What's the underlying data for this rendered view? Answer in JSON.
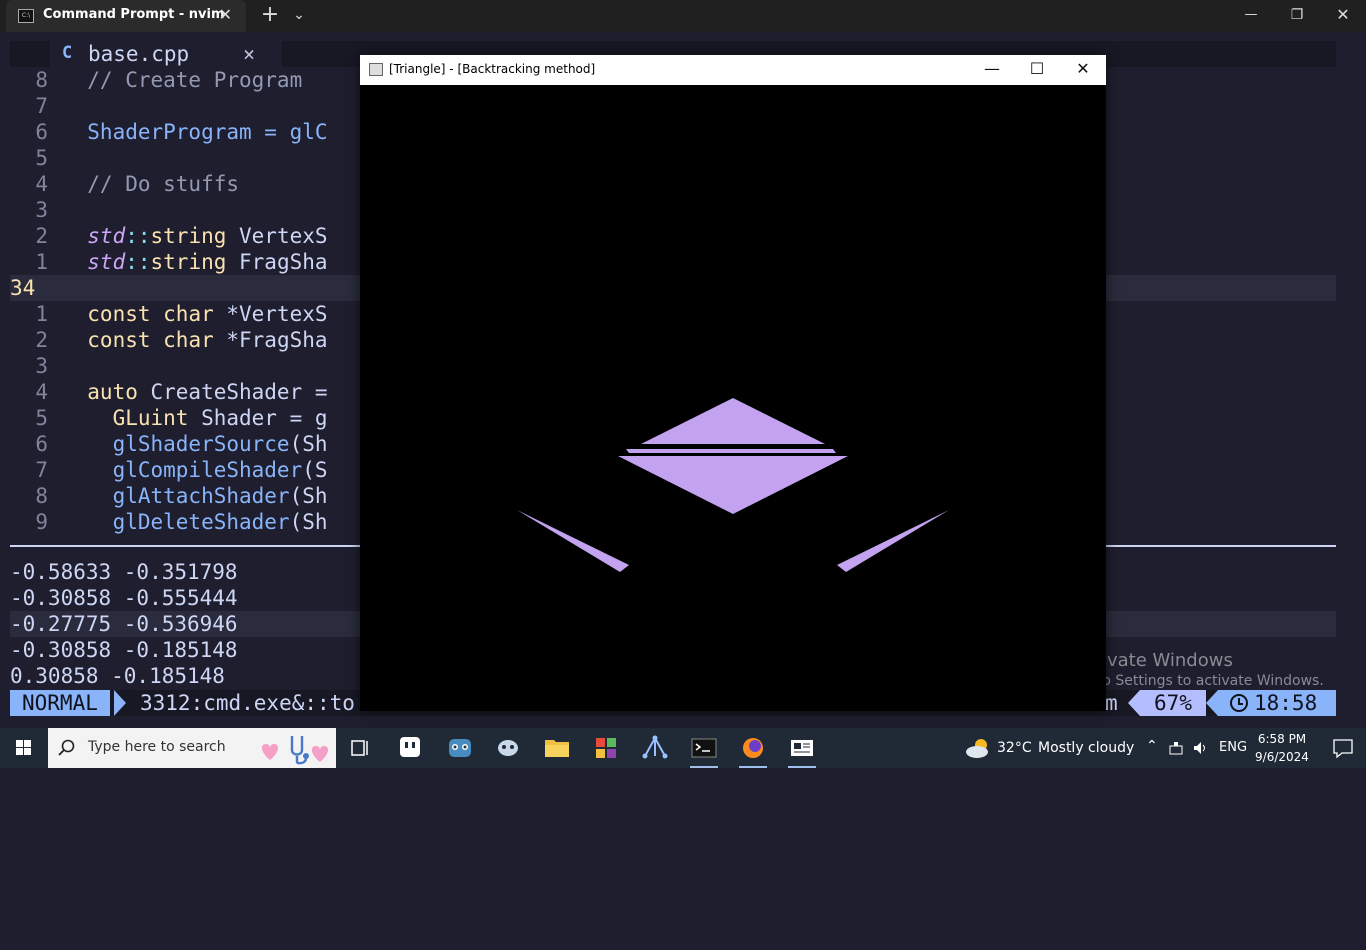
{
  "terminal": {
    "tab_title": "Command Prompt - nvim",
    "tab_close": "✕",
    "new_tab": "+",
    "dropdown": "⌄",
    "minimize": "—",
    "restore": "❐",
    "close": "✕",
    "tab_icon_text": "C:\\"
  },
  "editor": {
    "buffer_name": "base.cpp",
    "buffer_icon": "C",
    "buffer_close": "×",
    "lines": [
      {
        "num": "8",
        "text": "  // Create Program"
      },
      {
        "num": "7",
        "text": ""
      },
      {
        "num": "6",
        "text": "  ShaderProgram = glC"
      },
      {
        "num": "5",
        "text": ""
      },
      {
        "num": "4",
        "text": "  // Do stuffs"
      },
      {
        "num": "3",
        "text": ""
      },
      {
        "num": "2",
        "text_a": "  std",
        "text_b": "::",
        "text_c": "string",
        "text_d": " VertexS"
      },
      {
        "num": "1",
        "text_a": "  std",
        "text_b": "::",
        "text_c": "string",
        "text_d": " FragSha"
      },
      {
        "num": "34",
        "text": ""
      },
      {
        "num": "1",
        "text_a": "  const",
        "text_b": " char",
        "text_c": " *VertexS"
      },
      {
        "num": "2",
        "text_a": "  const",
        "text_b": " char",
        "text_c": " *FragSha"
      },
      {
        "num": "3",
        "text": ""
      },
      {
        "num": "4",
        "text_a": "  auto",
        "text_b": " CreateShader =",
        "text_c": ""
      },
      {
        "num": "5",
        "text_a": "    GLuint",
        "text_b": " Shader = g"
      },
      {
        "num": "6",
        "text_a": "    glShaderSource",
        "text_b": "(Sh"
      },
      {
        "num": "7",
        "text_a": "    glCompileShader",
        "text_b": "(S"
      },
      {
        "num": "8",
        "text_a": "    glAttachShader",
        "text_b": "(Sh"
      },
      {
        "num": "9",
        "text_a": "    glDeleteShader",
        "text_b": "(Sh"
      }
    ]
  },
  "output": {
    "lines": [
      "-0.58633 -0.351798",
      "-0.30858 -0.555444",
      "-0.27775 -0.536946",
      "-0.30858 -0.185148",
      "0.30858 -0.185148"
    ]
  },
  "statusline": {
    "mode": "NORMAL",
    "file": "3312:cmd.exe&::to",
    "right_fragment": "m",
    "percent": "67%",
    "time": "18:58"
  },
  "watermark": {
    "line1": "Activate Windows",
    "line2": "Go to Settings to activate Windows."
  },
  "glwindow": {
    "title": "[Triangle] - [Backtracking method]",
    "minimize": "—",
    "maximize": "☐",
    "close": "✕",
    "shape_color": "#c3a3f0"
  },
  "taskbar": {
    "search_placeholder": "Type here to search",
    "weather_temp": "32°C",
    "weather_text": "Mostly cloudy",
    "language": "ENG",
    "time": "6:58 PM",
    "date": "9/6/2024",
    "icons": [
      "task-view-icon",
      "app-icon",
      "godot-icon",
      "discord-icon",
      "file-explorer-icon",
      "app-grid-icon",
      "git-icon",
      "terminal-icon",
      "firefox-icon",
      "news-icon"
    ]
  }
}
